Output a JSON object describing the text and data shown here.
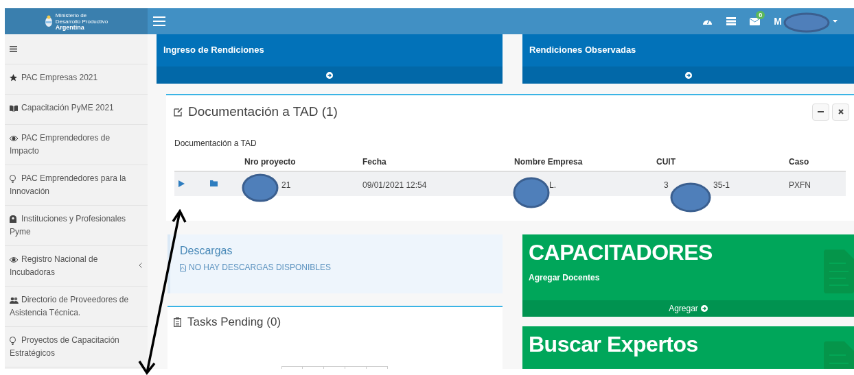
{
  "brand": {
    "lines": [
      "Ministerio de",
      "Desarrollo Productivo",
      "Argentina"
    ]
  },
  "header": {
    "notifications_badge": "0",
    "user_name_visible": "M"
  },
  "sidebar": {
    "items": [
      {
        "label": "PAC Empresas 2021",
        "expandable": false
      },
      {
        "label": "Capacitación PyME 2021",
        "expandable": false
      },
      {
        "label": "PAC Emprendedores de Impacto",
        "expandable": false
      },
      {
        "label": "PAC Emprendedores para la Innovación",
        "expandable": false
      },
      {
        "label": "Instituciones y Profesionales Pyme",
        "expandable": false
      },
      {
        "label": "Registro Nacional de Incubadoras",
        "expandable": true
      },
      {
        "label": "Directorio de Proveedores de Asistencia Técnica.",
        "expandable": false
      },
      {
        "label": "Proyectos de Capacitación Estratégicos",
        "expandable": false
      }
    ]
  },
  "top_cards": [
    {
      "title": "Ingreso de Rendiciones"
    },
    {
      "title": "Rendiciones Observadas"
    }
  ],
  "tad_panel": {
    "title": "Documentación a TAD (1)",
    "subtitle": "Documentación a TAD",
    "table": {
      "columns": [
        "Nro proyecto",
        "Fecha",
        "Nombre Empresa",
        "CUIT",
        "Caso"
      ],
      "rows": [
        {
          "cells": [
            [
              "21"
            ],
            [
              "09/01/2021 12:54"
            ],
            [
              "L."
            ],
            [
              "3",
              "35-1"
            ],
            [
              "PXFN"
            ]
          ]
        }
      ]
    }
  },
  "downloads": {
    "title": "Descargas",
    "message": "NO HAY DESCARGAS DISPONIBLES"
  },
  "tasks": {
    "title": "Tasks Pending (0)"
  },
  "green_cards": [
    {
      "title": "CAPACITADORES",
      "subtitle": "Agregar Docentes",
      "action": "Agregar"
    },
    {
      "title": "Buscar Expertos"
    }
  ]
}
